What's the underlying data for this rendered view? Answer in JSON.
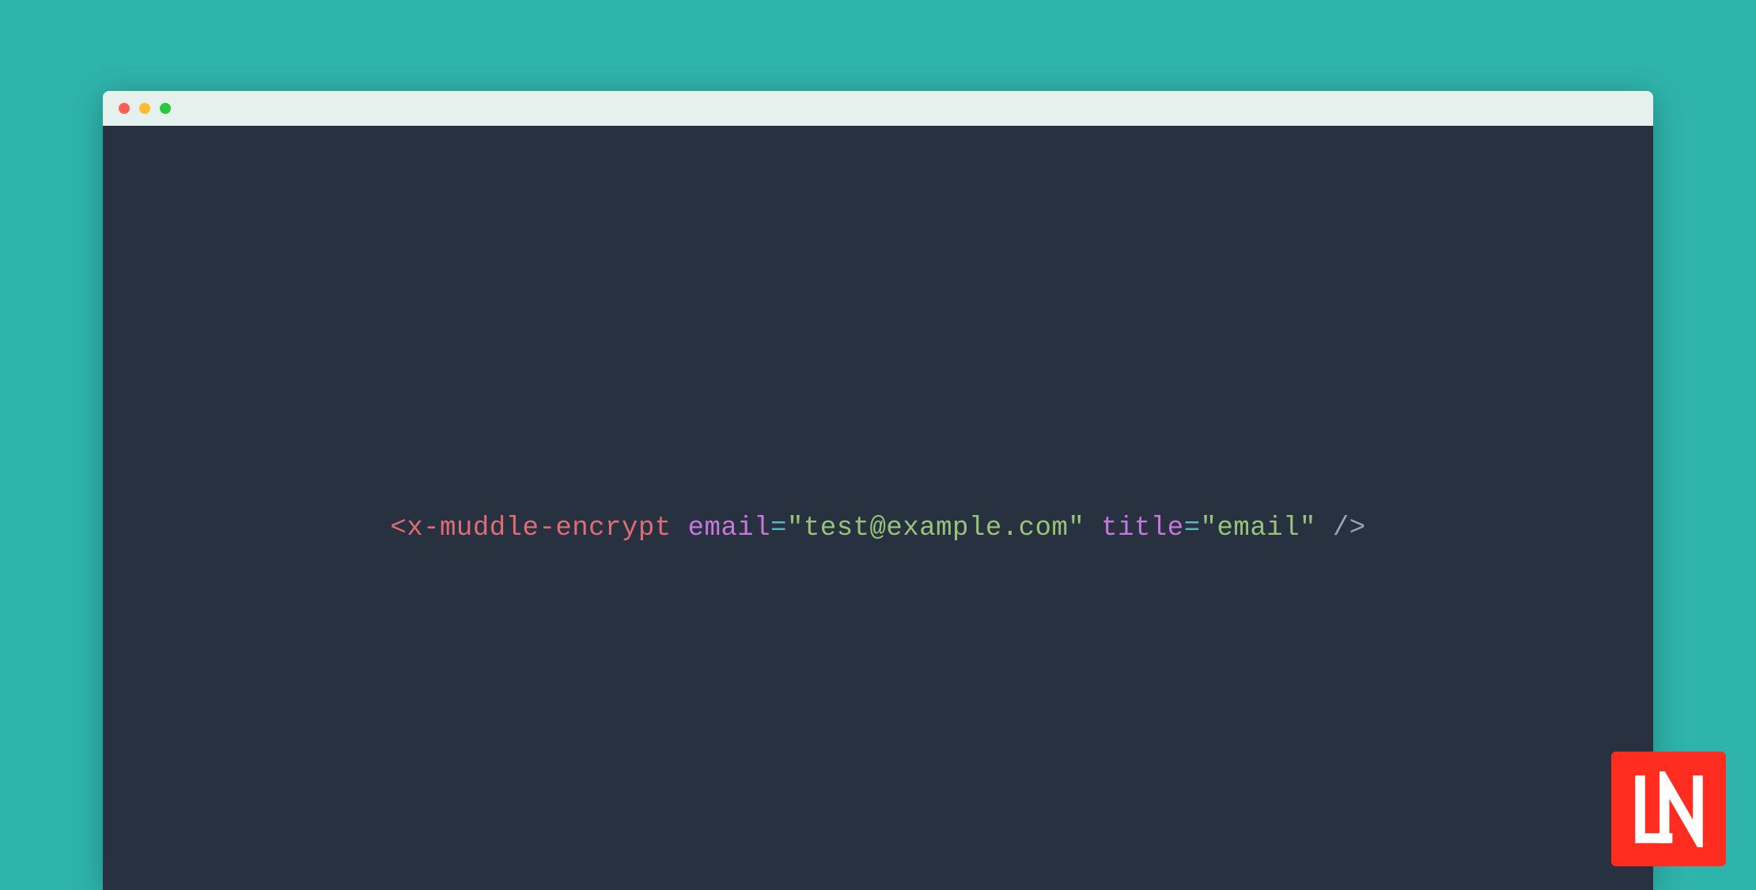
{
  "window": {
    "traffic_light_colors": {
      "close": "#ff5f57",
      "minimize": "#febc2e",
      "maximize": "#28c840"
    }
  },
  "code": {
    "open_bracket": "<",
    "tag_name": "x-muddle-encrypt",
    "space": " ",
    "attr1_name": "email",
    "eq": "=",
    "attr1_value": "\"test@example.com\"",
    "attr2_name": "title",
    "attr2_value": "\"email\"",
    "self_close": " />"
  },
  "logo": {
    "text": "LN",
    "bg_color": "#ff2d20",
    "fg_color": "#ffffff"
  },
  "colors": {
    "page_bg": "#2eb4ab",
    "editor_bg": "#27313f",
    "titlebar_bg": "#e6f0ed"
  }
}
